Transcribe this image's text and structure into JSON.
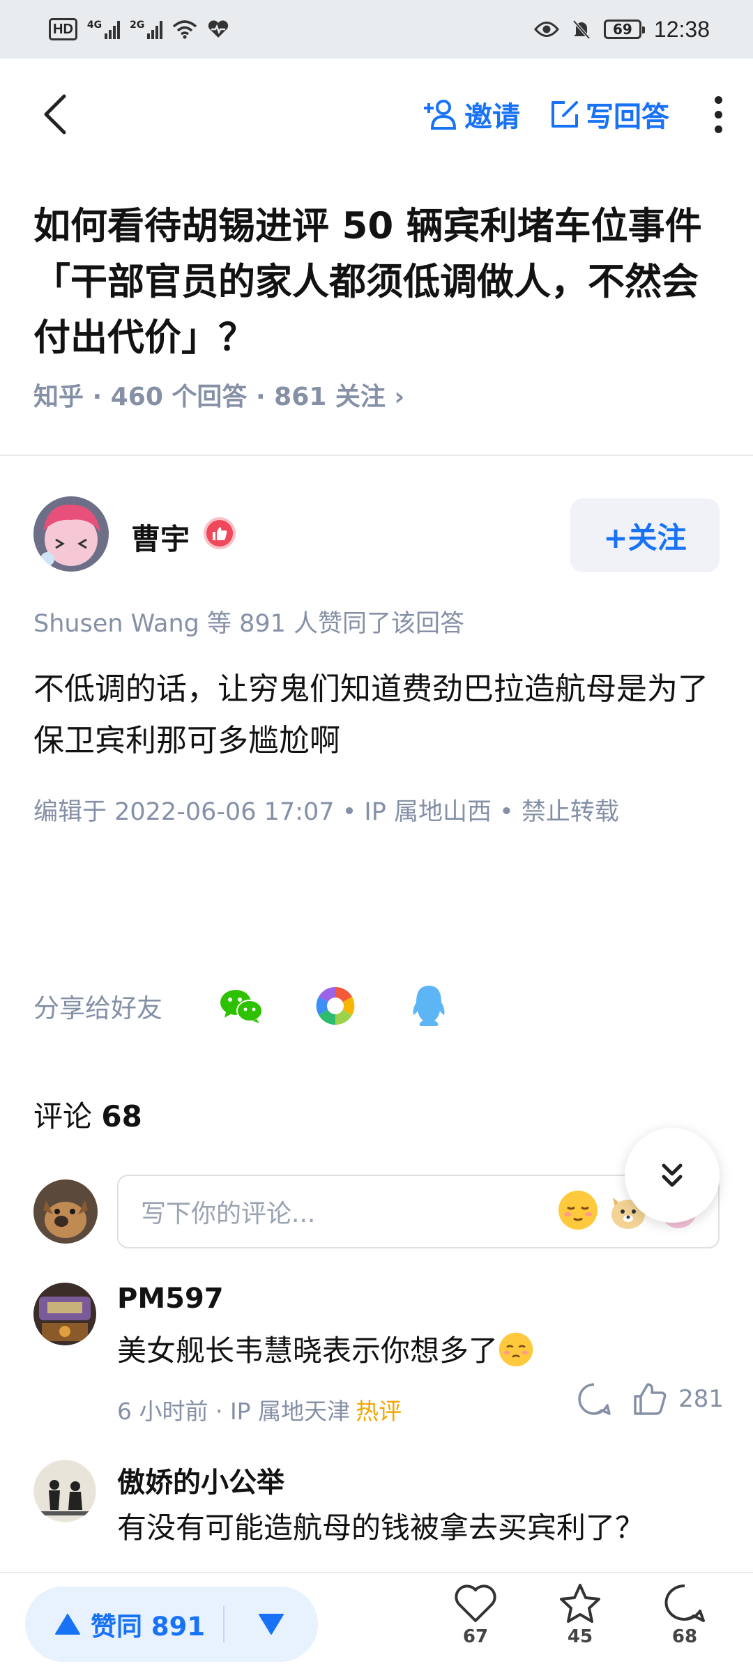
{
  "status_bar": {
    "hd": "HD",
    "net1": "4G",
    "net2": "2G",
    "battery": "69",
    "time": "12:38"
  },
  "nav": {
    "invite_label": "邀请",
    "write_answer_label": "写回答"
  },
  "question": {
    "title": "如何看待胡锡进评 50 辆宾利堵车位事件「干部官员的家人都须低调做人，不然会付出代价」？",
    "meta": "知乎 · 460 个回答 · 861 关注 ›"
  },
  "author": {
    "name": "曹宇",
    "follow_label": "+关注"
  },
  "answer": {
    "upvoters": "Shusen Wang 等 891 人赞同了该回答",
    "text": "不低调的话，让穷鬼们知道费劲巴拉造航母是为了保卫宾利那可多尴尬啊",
    "meta": "编辑于 2022-06-06 17:07 • IP 属地山西 • 禁止转载"
  },
  "share": {
    "label": "分享给好友"
  },
  "comments": {
    "header_label": "评论",
    "count": "68",
    "input_placeholder": "写下你的评论...",
    "items": [
      {
        "name": "PM597",
        "text": "美女舰长韦慧晓表示你想多了",
        "time": "6 小时前 · IP 属地天津",
        "hot": "热评",
        "likes": "281"
      },
      {
        "name": "傲娇的小公举",
        "text": "有没有可能造航母的钱被拿去买宾利了？"
      }
    ]
  },
  "bottom_bar": {
    "upvote_label": "赞同 891",
    "like_count": "67",
    "favorite_count": "45",
    "comment_count": "68"
  },
  "colors": {
    "accent": "#1772f6",
    "meta": "#8590a6",
    "hot": "#f1a600"
  }
}
